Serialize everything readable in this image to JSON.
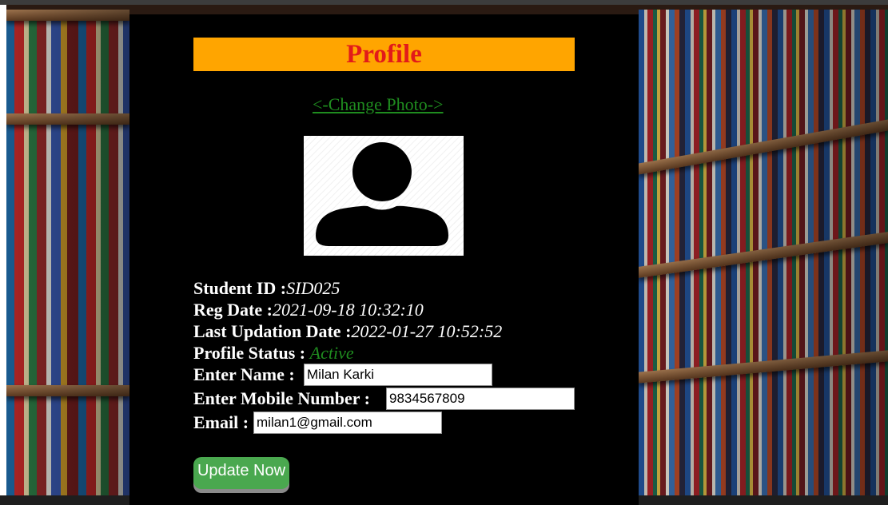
{
  "profile": {
    "title": "Profile",
    "change_photo_label": "<-Change Photo->",
    "student_id_label": "Student ID :",
    "student_id_value": "SID025",
    "reg_date_label": "Reg Date :",
    "reg_date_value": "2021-09-18 10:32:10",
    "last_updation_label": "Last Updation Date :",
    "last_updation_value": "2022-01-27 10:52:52",
    "profile_status_label": "Profile Status : ",
    "profile_status_value": "Active",
    "name_label": "Enter Name :",
    "name_value": "Milan Karki",
    "mobile_label": "Enter Mobile Number :",
    "mobile_value": "9834567809",
    "email_label": "Email :",
    "email_value": "milan1@gmail.com",
    "update_button_label": "Update Now"
  },
  "icons": {
    "avatar": "user-silhouette-icon"
  },
  "colors": {
    "title_bg": "#ffa500",
    "title_text": "#e21a1a",
    "link_green": "#1f8c1f",
    "button_green": "#4aa84f",
    "panel_bg": "#000000"
  }
}
